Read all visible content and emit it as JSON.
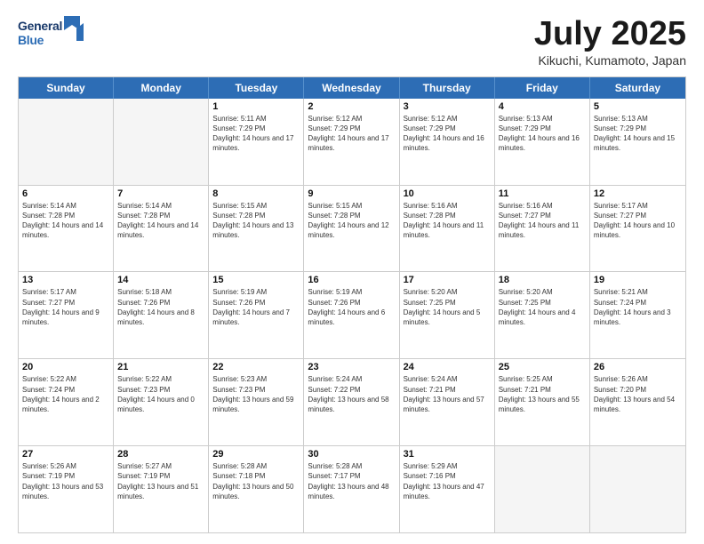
{
  "header": {
    "logo": {
      "line1": "General",
      "line2": "Blue"
    },
    "title": "July 2025",
    "location": "Kikuchi, Kumamoto, Japan"
  },
  "calendar": {
    "days_of_week": [
      "Sunday",
      "Monday",
      "Tuesday",
      "Wednesday",
      "Thursday",
      "Friday",
      "Saturday"
    ],
    "weeks": [
      [
        {
          "day": "",
          "info": ""
        },
        {
          "day": "",
          "info": ""
        },
        {
          "day": "1",
          "info": "Sunrise: 5:11 AM\nSunset: 7:29 PM\nDaylight: 14 hours and 17 minutes."
        },
        {
          "day": "2",
          "info": "Sunrise: 5:12 AM\nSunset: 7:29 PM\nDaylight: 14 hours and 17 minutes."
        },
        {
          "day": "3",
          "info": "Sunrise: 5:12 AM\nSunset: 7:29 PM\nDaylight: 14 hours and 16 minutes."
        },
        {
          "day": "4",
          "info": "Sunrise: 5:13 AM\nSunset: 7:29 PM\nDaylight: 14 hours and 16 minutes."
        },
        {
          "day": "5",
          "info": "Sunrise: 5:13 AM\nSunset: 7:29 PM\nDaylight: 14 hours and 15 minutes."
        }
      ],
      [
        {
          "day": "6",
          "info": "Sunrise: 5:14 AM\nSunset: 7:28 PM\nDaylight: 14 hours and 14 minutes."
        },
        {
          "day": "7",
          "info": "Sunrise: 5:14 AM\nSunset: 7:28 PM\nDaylight: 14 hours and 14 minutes."
        },
        {
          "day": "8",
          "info": "Sunrise: 5:15 AM\nSunset: 7:28 PM\nDaylight: 14 hours and 13 minutes."
        },
        {
          "day": "9",
          "info": "Sunrise: 5:15 AM\nSunset: 7:28 PM\nDaylight: 14 hours and 12 minutes."
        },
        {
          "day": "10",
          "info": "Sunrise: 5:16 AM\nSunset: 7:28 PM\nDaylight: 14 hours and 11 minutes."
        },
        {
          "day": "11",
          "info": "Sunrise: 5:16 AM\nSunset: 7:27 PM\nDaylight: 14 hours and 11 minutes."
        },
        {
          "day": "12",
          "info": "Sunrise: 5:17 AM\nSunset: 7:27 PM\nDaylight: 14 hours and 10 minutes."
        }
      ],
      [
        {
          "day": "13",
          "info": "Sunrise: 5:17 AM\nSunset: 7:27 PM\nDaylight: 14 hours and 9 minutes."
        },
        {
          "day": "14",
          "info": "Sunrise: 5:18 AM\nSunset: 7:26 PM\nDaylight: 14 hours and 8 minutes."
        },
        {
          "day": "15",
          "info": "Sunrise: 5:19 AM\nSunset: 7:26 PM\nDaylight: 14 hours and 7 minutes."
        },
        {
          "day": "16",
          "info": "Sunrise: 5:19 AM\nSunset: 7:26 PM\nDaylight: 14 hours and 6 minutes."
        },
        {
          "day": "17",
          "info": "Sunrise: 5:20 AM\nSunset: 7:25 PM\nDaylight: 14 hours and 5 minutes."
        },
        {
          "day": "18",
          "info": "Sunrise: 5:20 AM\nSunset: 7:25 PM\nDaylight: 14 hours and 4 minutes."
        },
        {
          "day": "19",
          "info": "Sunrise: 5:21 AM\nSunset: 7:24 PM\nDaylight: 14 hours and 3 minutes."
        }
      ],
      [
        {
          "day": "20",
          "info": "Sunrise: 5:22 AM\nSunset: 7:24 PM\nDaylight: 14 hours and 2 minutes."
        },
        {
          "day": "21",
          "info": "Sunrise: 5:22 AM\nSunset: 7:23 PM\nDaylight: 14 hours and 0 minutes."
        },
        {
          "day": "22",
          "info": "Sunrise: 5:23 AM\nSunset: 7:23 PM\nDaylight: 13 hours and 59 minutes."
        },
        {
          "day": "23",
          "info": "Sunrise: 5:24 AM\nSunset: 7:22 PM\nDaylight: 13 hours and 58 minutes."
        },
        {
          "day": "24",
          "info": "Sunrise: 5:24 AM\nSunset: 7:21 PM\nDaylight: 13 hours and 57 minutes."
        },
        {
          "day": "25",
          "info": "Sunrise: 5:25 AM\nSunset: 7:21 PM\nDaylight: 13 hours and 55 minutes."
        },
        {
          "day": "26",
          "info": "Sunrise: 5:26 AM\nSunset: 7:20 PM\nDaylight: 13 hours and 54 minutes."
        }
      ],
      [
        {
          "day": "27",
          "info": "Sunrise: 5:26 AM\nSunset: 7:19 PM\nDaylight: 13 hours and 53 minutes."
        },
        {
          "day": "28",
          "info": "Sunrise: 5:27 AM\nSunset: 7:19 PM\nDaylight: 13 hours and 51 minutes."
        },
        {
          "day": "29",
          "info": "Sunrise: 5:28 AM\nSunset: 7:18 PM\nDaylight: 13 hours and 50 minutes."
        },
        {
          "day": "30",
          "info": "Sunrise: 5:28 AM\nSunset: 7:17 PM\nDaylight: 13 hours and 48 minutes."
        },
        {
          "day": "31",
          "info": "Sunrise: 5:29 AM\nSunset: 7:16 PM\nDaylight: 13 hours and 47 minutes."
        },
        {
          "day": "",
          "info": ""
        },
        {
          "day": "",
          "info": ""
        }
      ]
    ]
  }
}
